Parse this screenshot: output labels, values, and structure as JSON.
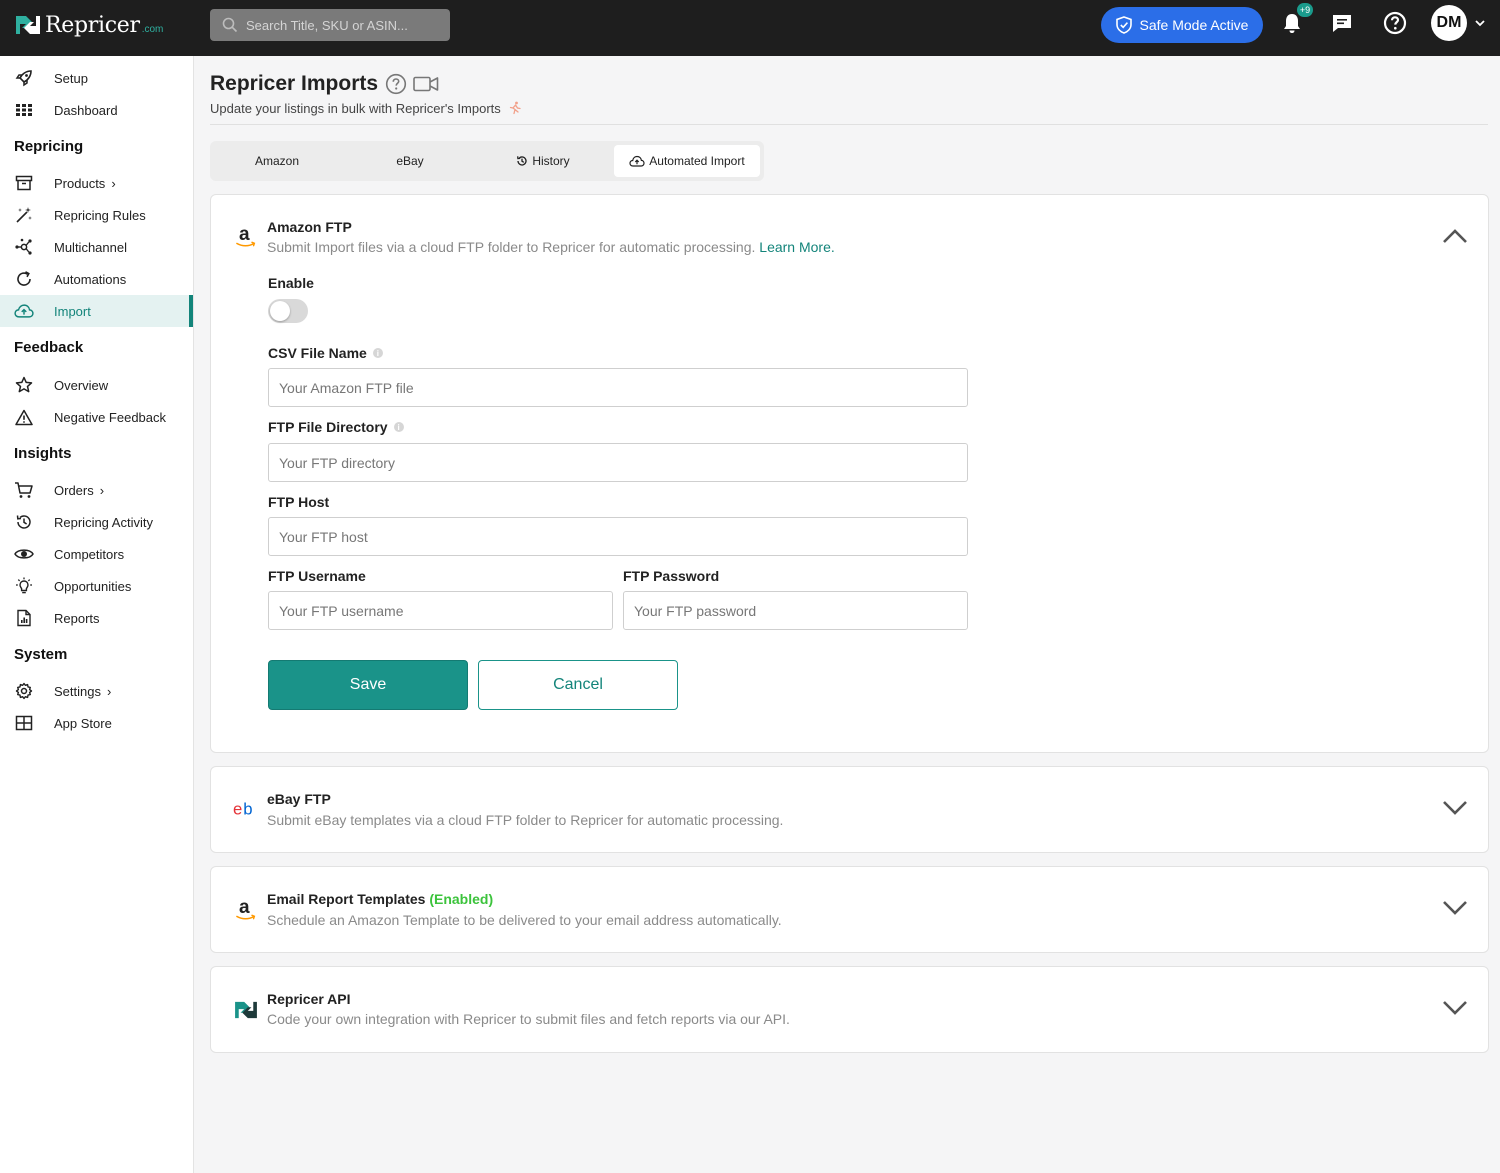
{
  "brand": {
    "name": "Repricer",
    "suffix": ".com"
  },
  "search": {
    "placeholder": "Search Title, SKU or ASIN..."
  },
  "header": {
    "safe_mode_label": "Safe Mode Active",
    "notification_badge": "+9",
    "avatar_initials": "DM",
    "accent_color": "#2b6ee8"
  },
  "sidebar": {
    "top_items": [
      {
        "label": "Setup",
        "icon": "rocket-icon"
      },
      {
        "label": "Dashboard",
        "icon": "dashboard-grid-icon"
      }
    ],
    "sections": {
      "repricing": "Repricing",
      "feedback": "Feedback",
      "insights": "Insights",
      "system": "System"
    },
    "repricing_items": [
      {
        "label": "Products",
        "icon": "archive-box-icon",
        "has_chevron": true
      },
      {
        "label": "Repricing Rules",
        "icon": "magic-wand-icon"
      },
      {
        "label": "Multichannel",
        "icon": "network-icon"
      },
      {
        "label": "Automations",
        "icon": "refresh-icon"
      },
      {
        "label": "Import",
        "icon": "cloud-upload-icon",
        "active": true
      }
    ],
    "feedback_items": [
      {
        "label": "Overview",
        "icon": "star-icon"
      },
      {
        "label": "Negative Feedback",
        "icon": "warning-icon"
      }
    ],
    "insights_items": [
      {
        "label": "Orders",
        "icon": "cart-icon",
        "has_chevron": true
      },
      {
        "label": "Repricing Activity",
        "icon": "history-icon"
      },
      {
        "label": "Competitors",
        "icon": "eye-icon"
      },
      {
        "label": "Opportunities",
        "icon": "lightbulb-icon"
      },
      {
        "label": "Reports",
        "icon": "report-document-icon"
      }
    ],
    "system_items": [
      {
        "label": "Settings",
        "icon": "gear-icon",
        "has_chevron": true
      },
      {
        "label": "App Store",
        "icon": "app-grid-icon"
      }
    ],
    "chevron": "›"
  },
  "page": {
    "title": "Repricer Imports",
    "subtitle": "Update your listings in bulk with Repricer's Imports"
  },
  "tabs": [
    {
      "label": "Amazon"
    },
    {
      "label": "eBay"
    },
    {
      "label": "History"
    },
    {
      "label": "Automated Import",
      "active": true
    }
  ],
  "amazon_ftp": {
    "title": "Amazon FTP",
    "description": "Submit Import files via a cloud FTP folder to Repricer for automatic processing.",
    "learn_more": "Learn More.",
    "enable_label": "Enable",
    "enabled": false,
    "csv_label": "CSV File Name",
    "csv_placeholder": "Your Amazon FTP file",
    "dir_label": "FTP File Directory",
    "dir_placeholder": "Your FTP directory",
    "host_label": "FTP Host",
    "host_placeholder": "Your FTP host",
    "username_label": "FTP Username",
    "username_placeholder": "Your FTP username",
    "password_label": "FTP Password",
    "password_placeholder": "Your FTP password",
    "save_label": "Save",
    "cancel_label": "Cancel",
    "info_glyph": "i"
  },
  "ebay_ftp": {
    "title": "eBay FTP",
    "description": "Submit eBay templates via a cloud FTP folder to Repricer for automatic processing."
  },
  "email_templates": {
    "title": "Email Report Templates",
    "status": "(Enabled)",
    "description": "Schedule an Amazon Template to be delivered to your email address automatically."
  },
  "api": {
    "title": "Repricer API",
    "description": "Code your own integration with Repricer to submit files and fetch reports via our API."
  },
  "colors": {
    "primary": "#1a9389",
    "enabled_green": "#3cc33c",
    "ebay_e": "#e53238",
    "ebay_b": "#0064d2",
    "amazon_orange": "#ff9900"
  }
}
